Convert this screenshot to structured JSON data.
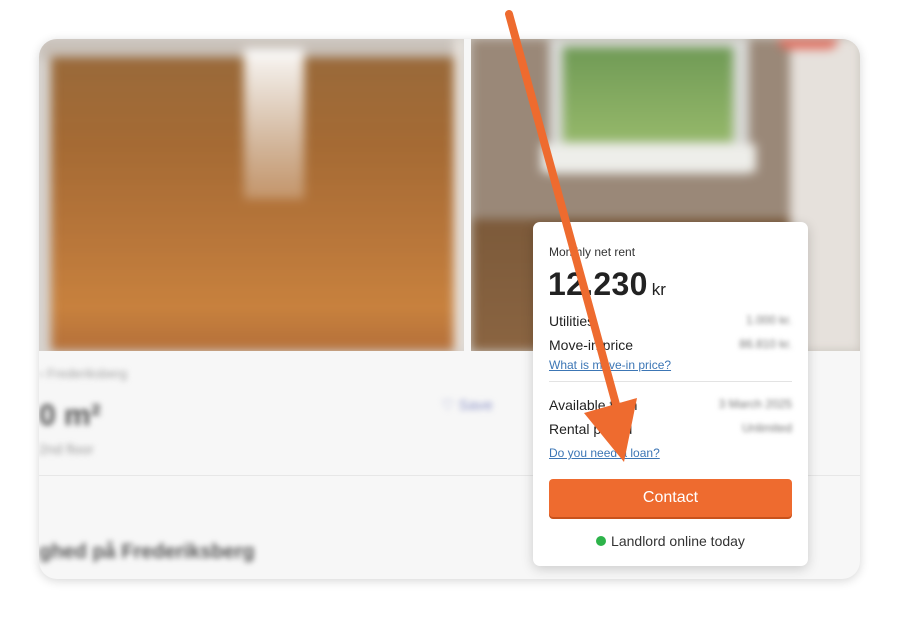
{
  "listing": {
    "breadcrumb": "› Frederiksberg",
    "size": "0 m²",
    "floor": "2nd floor",
    "save_label": "Save",
    "headline": "ghed på Frederiksberg"
  },
  "panel": {
    "rent_label": "Monthly net rent",
    "rent_amount": "12.230",
    "rent_unit": "kr",
    "utilities_label": "Utilities",
    "utilities_value": "1.000 kr.",
    "movein_label": "Move-in price",
    "movein_value": "86.810 kr.",
    "movein_link": "What is move-in price?",
    "available_label": "Available from",
    "available_value": "3 March 2025",
    "rental_label": "Rental period",
    "rental_value": "Unlimited",
    "loan_link": "Do you need a loan?",
    "contact_label": "Contact",
    "online_label": "Landlord online today"
  },
  "colors": {
    "accent": "#ee6b2f",
    "link": "#3c76b5",
    "online": "#2db34a",
    "annotation_arrow": "#ee6b2f"
  },
  "icons": {
    "save": "heart-icon",
    "status": "online-dot-icon",
    "annotation": "arrow-icon"
  }
}
